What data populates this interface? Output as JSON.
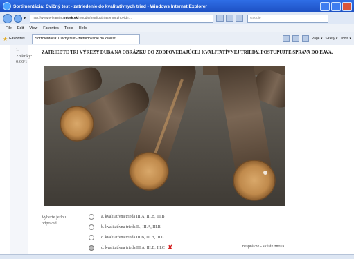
{
  "window": {
    "title": "Sortimentácia: Cvičný test - zatriedenie do kvalitatívnych tried - Windows Internet Explorer"
  },
  "browser": {
    "address_host": "nlcsk.sk",
    "search_placeholder": "Google",
    "menu": [
      "File",
      "Edit",
      "View",
      "Favorites",
      "Tools",
      "Help"
    ],
    "favorites_label": "Favorites",
    "tab_title": "Sortimentácia: Cvičný test - zatriedovanie do kvalitat...",
    "commands": {
      "page": "Page ▾",
      "safety": "Safety ▾",
      "tools": "Tools ▾"
    }
  },
  "quiz": {
    "question_number": "1.",
    "score_label": "Známky:",
    "score_value": "0.00/1",
    "question": "ZATRIEDTE TRI VÝREZY DUBA NA OBRÁZKU DO ZODPOVEDAJÚCEJ KVALITATÍVNEJ TRIEDY. POSTUPUJTE SPRAVA DO ĽAVA.",
    "choose_label": "Vyberte jednu odpoveď",
    "options": [
      {
        "label": "a. kvalitatívna trieda III.A, III.B, III.B",
        "selected": false
      },
      {
        "label": "b. kvalitatívna trieda II., III.A, III.B",
        "selected": false
      },
      {
        "label": "c. kvalitatívna trieda III.B, III.B, III.C",
        "selected": false
      },
      {
        "label": "d. kvalitatívna trieda III.A, III.B, III.C",
        "selected": true,
        "incorrect": true
      }
    ],
    "feedback": "nesprávne - skúste znova"
  }
}
